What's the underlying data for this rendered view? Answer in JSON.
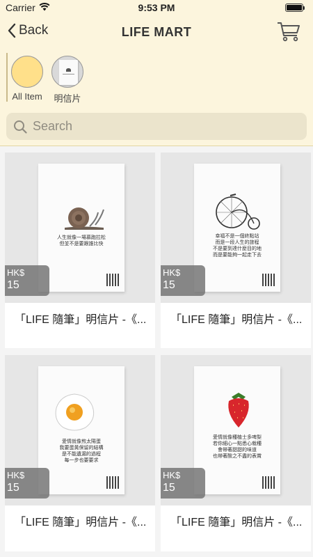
{
  "status_bar": {
    "carrier": "Carrier",
    "time": "9:53 PM"
  },
  "nav": {
    "back_label": "Back",
    "title": "LIFE MART"
  },
  "categories": [
    {
      "label": "All Item",
      "color": "#ffe08a"
    },
    {
      "label": "明信片",
      "color": "#f2f2f2"
    }
  ],
  "search": {
    "placeholder": "Search",
    "value": ""
  },
  "products": [
    {
      "title": "「LIFE 隨筆」明信片 -《...",
      "currency": "HK$",
      "price": "15",
      "lines": [
        "人生就像一場慕跑拉松",
        "但並不是要跟誰比快"
      ]
    },
    {
      "title": "「LIFE 隨筆」明信片 -《...",
      "currency": "HK$",
      "price": "15",
      "lines": [
        "幸福不是一個終點站",
        "而是一段人生的旅程",
        "不是要到達什麼目的地",
        "而是要能夠一起走下去"
      ]
    },
    {
      "title": "「LIFE 隨筆」明信片 -《...",
      "currency": "HK$",
      "price": "15",
      "lines": [
        "愛情就像煎太陽蛋",
        "我要蛋黃保留的結構",
        "是不能遺漏的過程",
        "每一步也要要求"
      ]
    },
    {
      "title": "「LIFE 隨筆」明信片 -《...",
      "currency": "HK$",
      "price": "15",
      "lines": [
        "愛情就像種植士多啤梨",
        "若你細心一點悉心栽種",
        "會帶著甜甜的味道",
        "也帶著酸之不盡的表賞"
      ]
    }
  ],
  "colors": {
    "header_bg": "#fcf5dd",
    "accent": "#ffe08a",
    "badge_bg": "#6e6e6e"
  }
}
